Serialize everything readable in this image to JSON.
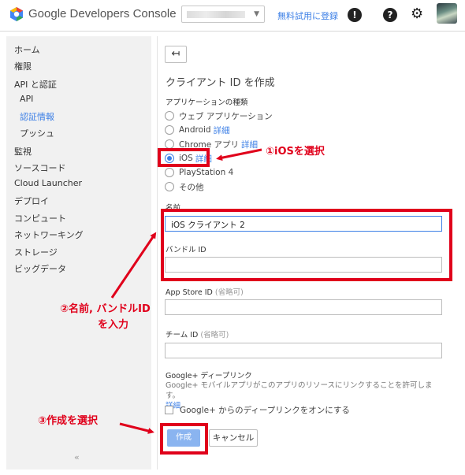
{
  "header": {
    "brand": "Google Developers Console",
    "trial_link": "無料試用に登録",
    "notification_glyph": "!",
    "help_glyph": "?",
    "gear_glyph": "⚙",
    "icons": [
      "google-cloud-logo",
      "notification-icon",
      "help-icon",
      "gear-icon",
      "avatar"
    ]
  },
  "sidebar": {
    "items": [
      {
        "label": "ホーム"
      },
      {
        "label": "権限"
      },
      {
        "label": "API と認証"
      },
      {
        "label": "API"
      },
      {
        "label": "認証情報"
      },
      {
        "label": "プッシュ"
      },
      {
        "label": "監視"
      },
      {
        "label": "ソースコード"
      },
      {
        "label": "Cloud Launcher"
      },
      {
        "label": "デプロイ"
      },
      {
        "label": "コンピュート"
      },
      {
        "label": "ネットワーキング"
      },
      {
        "label": "ストレージ"
      },
      {
        "label": "ビッグデータ"
      }
    ],
    "active_item": "認証情報",
    "collapse": "«"
  },
  "main": {
    "back_glyph": "↤",
    "title": "クライアント ID を作成",
    "app_type_label": "アプリケーションの種類",
    "app_types": [
      {
        "label": "ウェブ アプリケーション",
        "link": "",
        "selected": false
      },
      {
        "label": "Android",
        "link": "詳細",
        "selected": false
      },
      {
        "label": "Chrome アプリ",
        "link": "詳細",
        "selected": false
      },
      {
        "label": "iOS",
        "link": "詳細",
        "selected": true
      },
      {
        "label": "PlayStation 4",
        "link": "",
        "selected": false
      },
      {
        "label": "その他",
        "link": "",
        "selected": false
      }
    ],
    "name_label": "名前",
    "name_value": "iOS クライアント 2",
    "bundle_label": "バンドル ID",
    "bundle_value": "",
    "appstore_label": "App Store ID",
    "appstore_optional": "(省略可)",
    "appstore_value": "",
    "team_label": "チーム ID",
    "team_optional": "(省略可)",
    "team_value": "",
    "deeplink_label": "Google+ ディープリンク",
    "deeplink_help": "Google+ モバイルアプリがこのアプリのリソースにリンクすることを許可します。",
    "deeplink_help_link": "詳細",
    "deeplink_checkbox": "Google+ からのディープリンクをオンにする",
    "create_button": "作成",
    "cancel_button": "キャンセル"
  },
  "annotations": {
    "step1": "①iOSを選択",
    "step2_line1": "②名前, バンドルID",
    "step2_line2": "を入力",
    "step3": "③作成を選択",
    "color": "#e0001b"
  },
  "colors": {
    "accent": "#3c7fe6",
    "sidebar_bg": "#f1f1f1",
    "annotation": "#e0001b"
  }
}
